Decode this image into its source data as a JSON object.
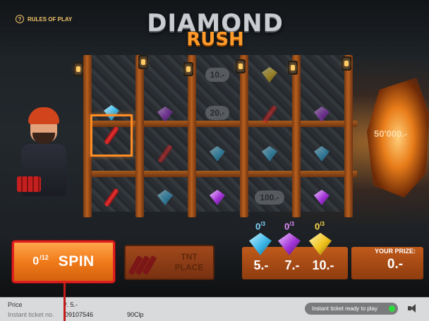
{
  "header": {
    "rules_label": "RULES OF PLAY",
    "title_line1": "DIAMOND",
    "title_line2": "RUSH"
  },
  "board": {
    "prize_chips": [
      "10.-",
      "20.-",
      "100.-"
    ],
    "background_text": "50'000.-"
  },
  "controls": {
    "spin_count": "0",
    "spin_total": "/12",
    "spin_label": "SPIN",
    "tnt_label_line1": "TNT",
    "tnt_label_line2": "PLACE"
  },
  "counters": [
    {
      "gem": "blue",
      "count": "0",
      "total": "/3",
      "prize": "5.-",
      "color": "#7fd6ff"
    },
    {
      "gem": "purple",
      "count": "0",
      "total": "/3",
      "prize": "7.-",
      "color": "#e08cff"
    },
    {
      "gem": "yellow",
      "count": "0",
      "total": "/3",
      "prize": "10.-",
      "color": "#ffd84a"
    }
  ],
  "your_prize": {
    "label": "YOUR PRIZE:",
    "value": "0.-"
  },
  "footer": {
    "price_label": "Price",
    "price_value": "/. 5.-",
    "ticket_label": "Instant ticket no.",
    "ticket_value": "09107546",
    "ticket_code": "90Clp",
    "ready_text": "Instant ticket ready to play"
  },
  "colors": {
    "accent_orange": "#f07b1b",
    "highlight_red": "#e02020",
    "ready_green": "#2bdc3c"
  }
}
